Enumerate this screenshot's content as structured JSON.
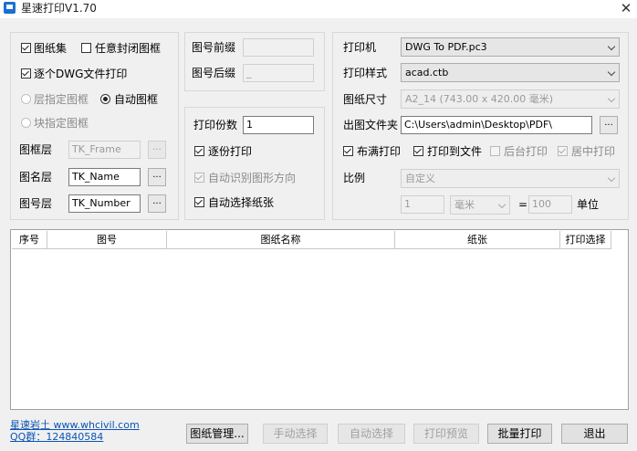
{
  "window": {
    "title": "星速打印V1.70",
    "close_glyph": "✕"
  },
  "left_panel": {
    "sheet_set": "图纸集",
    "any_closed_frame": "任意封闭图框",
    "each_dwg_print": "逐个DWG文件打印",
    "layer_frame": "层指定图框",
    "auto_frame": "自动图框",
    "block_frame": "块指定图框",
    "frame_layer_label": "图框层",
    "frame_layer_value": "TK_Frame",
    "name_layer_label": "图名层",
    "name_layer_value": "TK_Name",
    "number_layer_label": "图号层",
    "number_layer_value": "TK_Number",
    "browse_glyph": "..."
  },
  "mid_panel": {
    "prefix_label": "图号前缀",
    "prefix_value": "",
    "suffix_label": "图号后缀",
    "suffix_value": "_",
    "copies_label": "打印份数",
    "copies_value": "1",
    "collate": "逐份打印",
    "auto_orient": "自动识别图形方向",
    "auto_paper": "自动选择纸张"
  },
  "right_panel": {
    "printer_label": "打印机",
    "printer_value": "DWG To PDF.pc3",
    "style_label": "打印样式",
    "style_value": "acad.ctb",
    "size_label": "图纸尺寸",
    "size_value": "A2_14 (743.00 x 420.00 毫米)",
    "folder_label": "出图文件夹",
    "folder_value": "C:\\Users\\admin\\Desktop\\PDF\\",
    "browse_glyph": "...",
    "fill": "布满打印",
    "to_file": "打印到文件",
    "background": "后台打印",
    "center": "居中打印",
    "scale_label": "比例",
    "scale_value": "自定义",
    "scale_a": "1",
    "unit_value": "毫米",
    "equals": "=",
    "scale_b": "100",
    "unit_label": "单位"
  },
  "table": {
    "columns": [
      "序号",
      "图号",
      "图纸名称",
      "纸张",
      "打印选择"
    ],
    "rows": []
  },
  "footer": {
    "link1": "星速岩土 www.whcivil.com",
    "link2": "QQ群：124840584",
    "manage": "图纸管理...",
    "manual": "手动选择",
    "auto": "自动选择",
    "preview": "打印预览",
    "batch": "批量打印",
    "exit": "退出"
  }
}
